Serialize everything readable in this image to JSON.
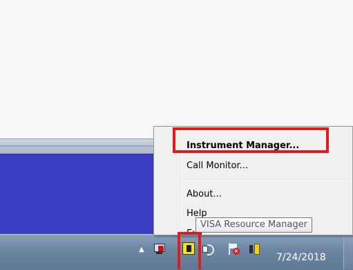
{
  "context_menu": {
    "items": [
      {
        "label": "Instrument Manager..."
      },
      {
        "label": "Call Monitor..."
      },
      {
        "label": "About..."
      },
      {
        "label": "Help"
      },
      {
        "label": "Exit"
      }
    ]
  },
  "tooltip": {
    "text": "VISA Resource Manager"
  },
  "taskbar": {
    "clock_date": "7/24/2018",
    "tray_icons": [
      "network-icon",
      "visa-icon",
      "volume-icon",
      "action-center-icon",
      "power-icon"
    ]
  },
  "colors": {
    "highlight": "#e11a1a",
    "blue_pane": "#3a3dc4",
    "taskbar": "#6c86a3",
    "visa_icon": "#f5e60a"
  }
}
